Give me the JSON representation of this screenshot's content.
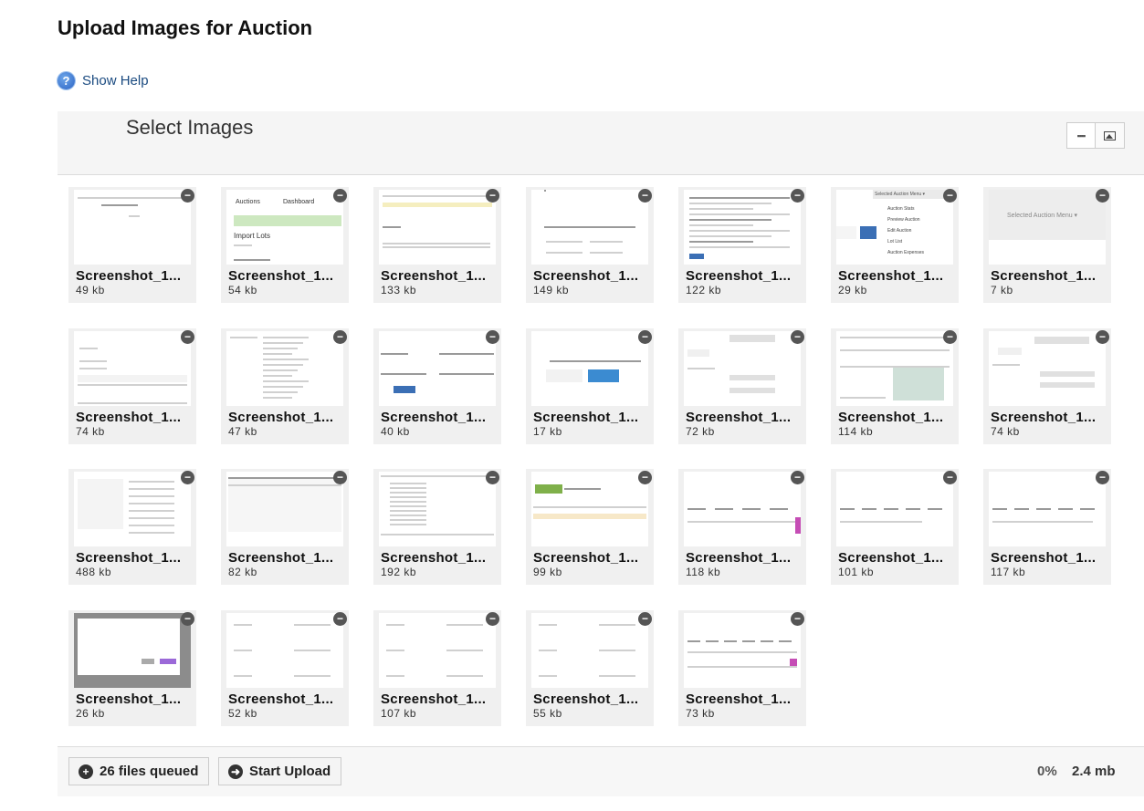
{
  "page": {
    "title": "Upload Images for Auction"
  },
  "help": {
    "label": "Show Help",
    "icon": "help-question-icon"
  },
  "uploader": {
    "title": "Select Images",
    "view_icons": [
      "grid-view-icon",
      "image-view-icon"
    ]
  },
  "files": [
    {
      "name": "Screenshot_1...",
      "size": "49 kb"
    },
    {
      "name": "Screenshot_1...",
      "size": "54 kb"
    },
    {
      "name": "Screenshot_1...",
      "size": "133 kb"
    },
    {
      "name": "Screenshot_1...",
      "size": "149 kb"
    },
    {
      "name": "Screenshot_1...",
      "size": "122 kb"
    },
    {
      "name": "Screenshot_1...",
      "size": "29 kb"
    },
    {
      "name": "Screenshot_1...",
      "size": "7 kb"
    },
    {
      "name": "Screenshot_1...",
      "size": "74 kb"
    },
    {
      "name": "Screenshot_1...",
      "size": "47 kb"
    },
    {
      "name": "Screenshot_1...",
      "size": "40 kb"
    },
    {
      "name": "Screenshot_1...",
      "size": "17 kb"
    },
    {
      "name": "Screenshot_1...",
      "size": "72 kb"
    },
    {
      "name": "Screenshot_1...",
      "size": "114 kb"
    },
    {
      "name": "Screenshot_1...",
      "size": "74 kb"
    },
    {
      "name": "Screenshot_1...",
      "size": "488 kb"
    },
    {
      "name": "Screenshot_1...",
      "size": "82 kb"
    },
    {
      "name": "Screenshot_1...",
      "size": "192 kb"
    },
    {
      "name": "Screenshot_1...",
      "size": "99 kb"
    },
    {
      "name": "Screenshot_1...",
      "size": "118 kb"
    },
    {
      "name": "Screenshot_1...",
      "size": "101 kb"
    },
    {
      "name": "Screenshot_1...",
      "size": "117 kb"
    },
    {
      "name": "Screenshot_1...",
      "size": "26 kb"
    },
    {
      "name": "Screenshot_1...",
      "size": "52 kb"
    },
    {
      "name": "Screenshot_1...",
      "size": "107 kb"
    },
    {
      "name": "Screenshot_1...",
      "size": "55 kb"
    },
    {
      "name": "Screenshot_1...",
      "size": "73 kb"
    }
  ],
  "thumb_text": {
    "t1_auctions": "Auctions",
    "t1_dashboard": "Dashboard",
    "t1_import": "Import Lots",
    "t6_menu": "Selected Auction Menu ▾",
    "t6_items": [
      "Auction Stats",
      "Preview Auction",
      "Edit Auction",
      "Lot List",
      "Auction Expenses"
    ],
    "t7_menu": "Selected Auction Menu ▾"
  },
  "footer": {
    "queued_label": "26 files queued",
    "start_label": "Start Upload",
    "progress": "0%",
    "total_size": "2.4 mb"
  }
}
